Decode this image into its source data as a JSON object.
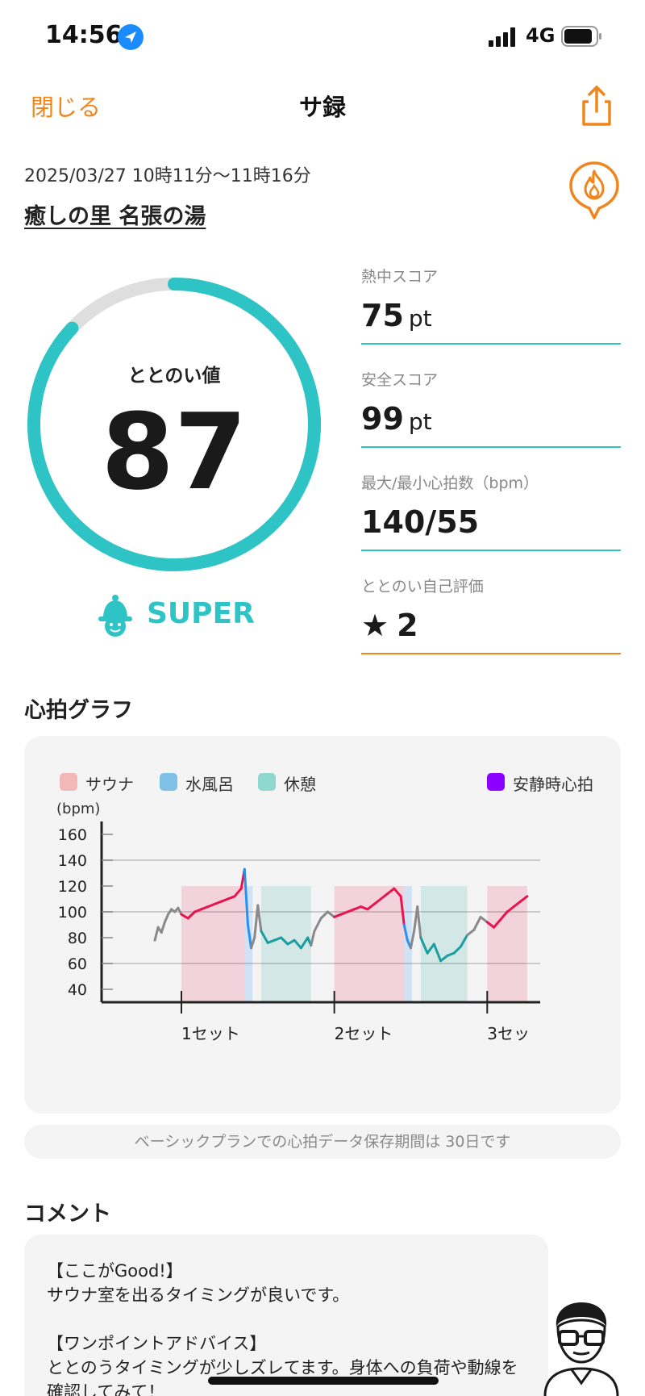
{
  "status_bar": {
    "time": "14:56",
    "network": "4G"
  },
  "nav": {
    "close": "閉じる",
    "title": "サ録"
  },
  "session": {
    "date_range": "2025/03/27 10時11分〜11時16分",
    "facility": "癒しの里 名張の湯"
  },
  "gauge": {
    "label": "ととのい値",
    "value": "87",
    "fill_fraction": 0.87,
    "color": "#2ec4c6",
    "track_color": "#dedede"
  },
  "rank": {
    "label": "SUPER"
  },
  "stats": [
    {
      "label": "熱中スコア",
      "value": "75",
      "unit": "pt"
    },
    {
      "label": "安全スコア",
      "value": "99",
      "unit": "pt"
    },
    {
      "label": "最大/最小心拍数（bpm）",
      "value": "140/55",
      "unit": ""
    },
    {
      "label": "ととのい自己評価",
      "value": "2",
      "unit": "",
      "star": "★"
    }
  ],
  "heart_graph": {
    "title": "心拍グラフ",
    "legend": [
      {
        "label": "サウナ",
        "color": "#f2b8b8"
      },
      {
        "label": "水風呂",
        "color": "#7fc0e6"
      },
      {
        "label": "休憩",
        "color": "#8ed8cf"
      },
      {
        "label": "安静時心拍",
        "color": "#8b00ff"
      }
    ]
  },
  "chart_data": {
    "type": "line",
    "ylabel": "(bpm)",
    "y_ticks": [
      160,
      140,
      120,
      100,
      80,
      60,
      40
    ],
    "ylim": [
      30,
      170
    ],
    "xlim": [
      0,
      65
    ],
    "x_tick_labels": [
      {
        "x": 4,
        "label": "1セット"
      },
      {
        "x": 27,
        "label": "2セット"
      },
      {
        "x": 50,
        "label": "3セッ"
      }
    ],
    "gridlines_y": [
      140,
      100,
      60
    ],
    "phase_colors": {
      "sauna": "#e8144f",
      "cold": "#2f8ff0",
      "rest": "#1a9fa0",
      "other": "#8a8a8a"
    },
    "phases": [
      {
        "type": "other",
        "start": 0,
        "end": 4
      },
      {
        "type": "sauna",
        "start": 4,
        "end": 13.5
      },
      {
        "type": "cold",
        "start": 13.5,
        "end": 14.7
      },
      {
        "type": "other",
        "start": 14.7,
        "end": 16
      },
      {
        "type": "rest",
        "start": 16,
        "end": 23.5
      },
      {
        "type": "other",
        "start": 23.5,
        "end": 27
      },
      {
        "type": "sauna",
        "start": 27,
        "end": 37.5
      },
      {
        "type": "cold",
        "start": 37.5,
        "end": 38.7
      },
      {
        "type": "other",
        "start": 38.7,
        "end": 40
      },
      {
        "type": "rest",
        "start": 40,
        "end": 47
      },
      {
        "type": "other",
        "start": 47,
        "end": 50
      },
      {
        "type": "sauna",
        "start": 50,
        "end": 56
      }
    ],
    "series": [
      {
        "x": [
          0,
          0.5,
          1,
          1.5,
          2,
          2.5,
          3,
          3.5,
          4,
          5,
          6,
          7,
          8,
          9,
          10,
          11,
          12,
          13,
          13.5,
          14,
          14.5,
          15,
          15.5,
          16,
          17,
          18,
          19,
          20,
          21,
          22,
          23,
          23.5,
          24,
          25,
          26,
          27,
          28,
          29,
          30,
          31,
          32,
          33,
          34,
          35,
          36,
          37,
          37.5,
          38,
          38.5,
          39,
          39.5,
          40,
          41,
          42,
          43,
          44,
          45,
          46,
          47,
          48,
          49,
          50,
          51,
          52,
          53,
          54,
          55,
          56
        ],
        "y": [
          78,
          88,
          84,
          92,
          98,
          102,
          100,
          103,
          98,
          95,
          100,
          102,
          104,
          106,
          108,
          110,
          112,
          118,
          133,
          90,
          72,
          80,
          105,
          85,
          76,
          78,
          80,
          75,
          78,
          72,
          80,
          74,
          85,
          95,
          100,
          96,
          98,
          100,
          102,
          104,
          102,
          106,
          110,
          114,
          118,
          112,
          90,
          78,
          72,
          85,
          104,
          80,
          68,
          75,
          62,
          66,
          68,
          73,
          82,
          86,
          96,
          92,
          88,
          94,
          100,
          104,
          108,
          112
        ]
      }
    ]
  },
  "retention_note": "ベーシックプランでの心拍データ保存期間は 30日です",
  "comment": {
    "title": "コメント",
    "lines": [
      "【ここがGood!】",
      "サウナ室を出るタイミングが良いです。",
      "",
      "【ワンポイントアドバイス】",
      "ととのうタイミングが少しズレてます。身体への負荷や動線を",
      "確認してみて！"
    ]
  }
}
